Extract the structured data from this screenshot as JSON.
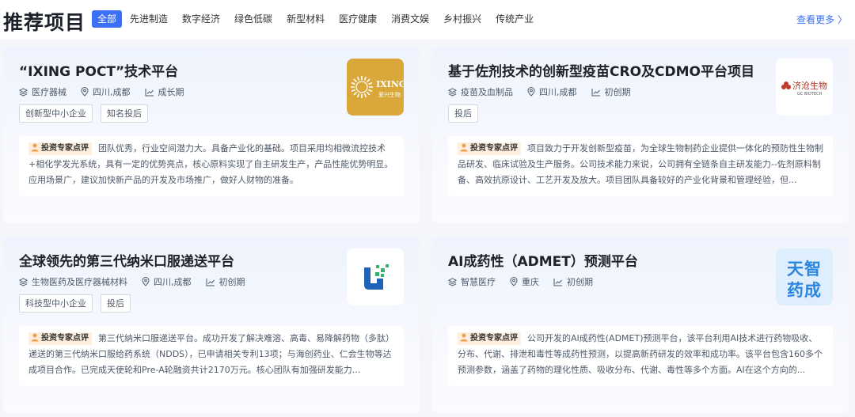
{
  "header": {
    "title": "推荐项目",
    "tabs": [
      "全部",
      "先进制造",
      "数字经济",
      "绿色低碳",
      "新型材料",
      "医疗健康",
      "消费文娱",
      "乡村振兴",
      "传统产业"
    ],
    "more": "查看更多 〉"
  },
  "badge_label": "投资专家点评",
  "cards": [
    {
      "title": "“IXING POCT”技术平台",
      "field": "医疗器械",
      "location": "四川,成都",
      "stage": "成长期",
      "tags": [
        "创新型中小企业",
        "知名投后"
      ],
      "logo_text": "IXING",
      "logo_sub": "爱兴生物",
      "comment": "团队优秀，行业空间潜力大。具备产业化的基础。项目采用均相微流控技术+相化学发光系统，具有一定的优势亮点，核心原料实现了自主研发生产，产品性能优势明显。应用场景广，建议加快新产品的开发及市场推广，做好人财物的准备。"
    },
    {
      "title": "基于佐剂技术的创新型疫苗CRO及CDMO平台项目",
      "field": "疫苗及血制品",
      "location": "四川,成都",
      "stage": "初创期",
      "tags": [
        "投后"
      ],
      "logo_text": "济沧生物",
      "logo_sub": "GC BIOTECH",
      "comment": "项目致力于开发创新型疫苗，为全球生物制药企业提供一体化的预防性生物制品研发、临床试验及生产服务。公司技术能力来说，公司拥有全链条自主研发能力--佐剂原料制备、高效抗原设计、工艺开发及放大。项目团队具备较好的产业化背景和管理经验，但..."
    },
    {
      "title": "全球领先的第三代纳米口服递送平台",
      "field": "生物医药及医疗器械材料",
      "location": "四川,成都",
      "stage": "初创期",
      "tags": [
        "科技型中小企业",
        "投后"
      ],
      "logo_text": "",
      "logo_sub": "",
      "comment": "第三代纳米口服递送平台。成功开发了解决难溶、高毒、易降解药物（多肽）递送的第三代纳米口服给药系统（NDDS），已申请相关专利13项；与海创药业、仁会生物等达成项目合作。已完成天使轮和Pre-A轮融资共计2170万元。核心团队有加强研发能力..."
    },
    {
      "title": "AI成药性（ADMET）预测平台",
      "field": "智慧医疗",
      "location": "重庆",
      "stage": "初创期",
      "tags": [],
      "logo_text": "天智",
      "logo_sub": "药成",
      "comment": "公司开发的AI成药性(ADMET)预测平台，该平台利用AI技术进行药物吸收、分布、代谢、排泄和毒性等成药性预测，以提高新药研发的效率和成功率。该平台包含160多个预测参数，涵盖了药物的理化性质、吸收分布、代谢、毒性等多个方面。AI在这个方向的..."
    }
  ],
  "colors": {
    "accent": "#3b6ff5",
    "logo1_bg": "#d9a73a",
    "logo4_text": "#2a86e0"
  }
}
